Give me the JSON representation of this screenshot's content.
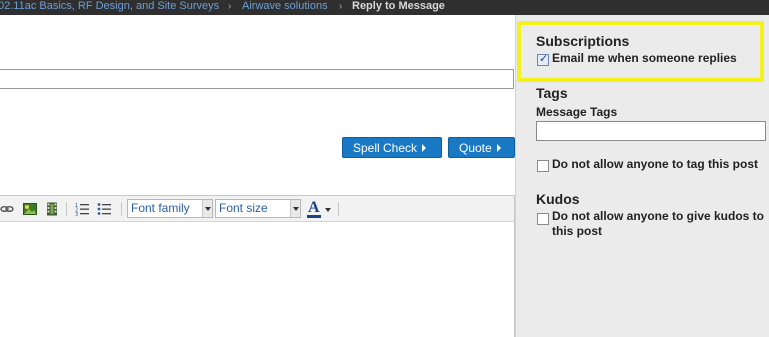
{
  "breadcrumb": {
    "items": [
      "02.11ac Basics, RF Design, and Site Surveys",
      "Airwave solutions"
    ],
    "current": "Reply to Message",
    "separator": "›"
  },
  "reply": {
    "subject_value": "",
    "spell_check_label": "Spell Check",
    "quote_label": "Quote"
  },
  "toolbar": {
    "font_family": "Font family",
    "font_size": "Font size",
    "font_color_label": "A",
    "icons": [
      "link-icon",
      "image-icon",
      "video-icon",
      "numbered-list-icon",
      "bulleted-list-icon",
      "font-color-icon"
    ]
  },
  "sidebar": {
    "subscriptions": {
      "title": "Subscriptions",
      "email_label": "Email me when someone replies",
      "email_checked": true
    },
    "tags": {
      "title": "Tags",
      "message_tags_label": "Message Tags",
      "message_tags_value": "",
      "no_tag_label": "Do not allow anyone to tag this post",
      "no_tag_checked": false
    },
    "kudos": {
      "title": "Kudos",
      "no_kudos_line1": "Do not allow anyone to give kudos to",
      "no_kudos_line2": "this post",
      "no_kudos_checked": false
    }
  },
  "colors": {
    "breadcrumb_bg": "#2f2f2f",
    "link": "#6e9fd4",
    "button": "#1a79c4",
    "highlight": "#f5f11a",
    "sidebar_bg": "#ebebeb"
  }
}
